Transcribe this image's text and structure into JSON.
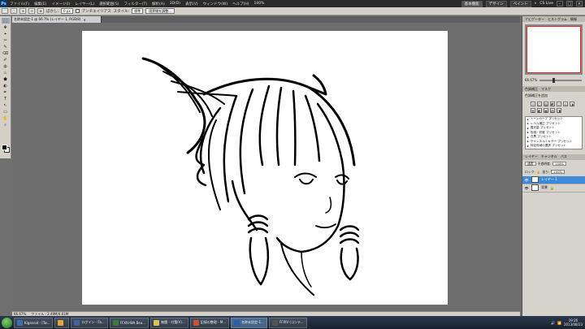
{
  "app": {
    "logo": "Ps",
    "menu": [
      "ファイル(F)",
      "編集(E)",
      "イメージ(I)",
      "レイヤー(L)",
      "選択範囲(S)",
      "フィルター(T)",
      "解析(A)",
      "3D(D)",
      "表示(V)",
      "ウィンドウ(W)",
      "ヘルプ(H)"
    ],
    "zoom": "100%",
    "workspaces": [
      "基本機能",
      "デザイン",
      "ペイント"
    ],
    "workspace_more": "»",
    "cs_live": "CS Live"
  },
  "options": {
    "feather_label": "ぼかし:",
    "feather_value": "0 px",
    "antialias_label": "アンチエイリアス",
    "style_label": "スタイル:",
    "style_value": "標準",
    "refine_button": "境界線を調整..."
  },
  "document": {
    "tab_title": "名称未設定-1 @ 66.7% (レイヤー 1, RGB/8)",
    "close": "×"
  },
  "tools": [
    "⬚",
    "✥",
    "⌖",
    "✂",
    "✎",
    "⌫",
    "✐",
    "◍",
    "♨",
    "⬟",
    "◐",
    "✒",
    "T",
    "↖",
    "▭",
    "✋",
    "⌕"
  ],
  "status": {
    "zoom": "66.67%",
    "doc_info": "ファイル : 2.49M/4.01M"
  },
  "navigator": {
    "tabs": [
      "ナビゲーター",
      "ヒストグラム",
      "情報"
    ],
    "zoom": "66.67%"
  },
  "adjustments": {
    "tabs": [
      "色調補正",
      "マスク"
    ],
    "title": "色調補正を追加",
    "icons": [
      "☼",
      "◫",
      "▨",
      "◩",
      "▽",
      "⚖",
      "◑",
      "▥",
      "◧",
      "▦",
      "▧",
      "◨"
    ],
    "presets": [
      "トーンカーブ プリセット",
      "レベル補正 プリセット",
      "露光量 プリセット",
      "色相・彩度 プリセット",
      "白黒 プリセット",
      "チャンネルミキサー プリセット",
      "特定色域の選択 プリセット"
    ]
  },
  "layers": {
    "tabs": [
      "レイヤー",
      "チャンネル",
      "パス"
    ],
    "blend": "通常",
    "opacity_label": "不透明度:",
    "opacity": "100%",
    "lock_label": "ロック:",
    "fill_label": "塗り:",
    "fill": "100%",
    "items": [
      {
        "name": "レイヤー 1",
        "selected": true
      },
      {
        "name": "背景",
        "selected": false
      }
    ]
  },
  "taskbar": {
    "apps": [
      {
        "label": "Kiganoid - [Tw...",
        "color": "#3a6fb0"
      },
      {
        "label": "",
        "color": "#e8a33a"
      },
      {
        "label": "ログイン - Fa...",
        "color": "#4060a8"
      },
      {
        "label": "FFXIV-WA Bea...",
        "color": "#3b7a3b"
      },
      {
        "label": "無題 - 付箋(V)...",
        "color": "#e0c050"
      },
      {
        "label": "記録の整理 - M...",
        "color": "#d05030"
      },
      {
        "label": "名称未設定-1...",
        "color": "#2b5fa8",
        "active": true
      },
      {
        "label": "FFXIV (コンテ...",
        "color": "#555"
      }
    ],
    "time": "19:26",
    "date": "2013/08/23"
  }
}
